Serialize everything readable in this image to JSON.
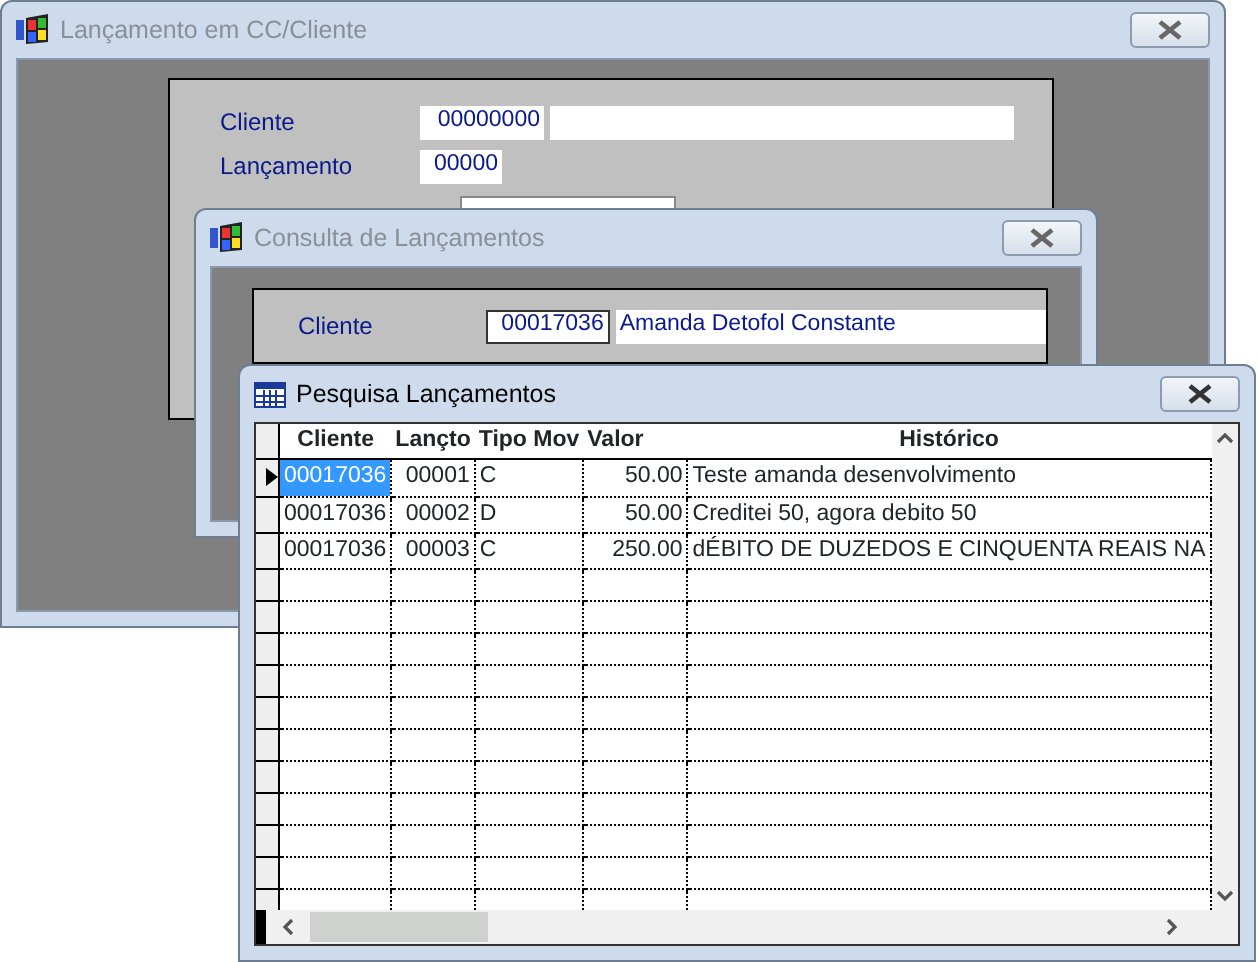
{
  "windows": [
    {
      "kind": "form",
      "title": "Lançamento em CC/Cliente",
      "active": false,
      "fields": [
        {
          "label": "Cliente",
          "values": [
            "00000000"
          ],
          "name_field": true
        },
        {
          "label": "Lançamento",
          "values": [
            "00000"
          ]
        }
      ]
    },
    {
      "kind": "form",
      "title": "Consulta de Lançamentos",
      "active": false,
      "fields": [
        {
          "label": "Cliente",
          "values": [
            "00017036",
            "Amanda Detofol Constante"
          ]
        }
      ]
    },
    {
      "kind": "grid",
      "title": "Pesquisa Lançamentos",
      "active": true,
      "table": {
        "columns": [
          "Cliente",
          "Lançto",
          "Tipo Mov",
          "Valor",
          "Histórico"
        ],
        "rows": [
          {
            "selected": true,
            "cells": [
              "00017036",
              "00001",
              "C",
              "50.00",
              "Teste amanda desenvolvimento"
            ]
          },
          {
            "selected": false,
            "cells": [
              "00017036",
              "00002",
              "D",
              "50.00",
              "Creditei 50, agora debito 50"
            ]
          },
          {
            "selected": false,
            "cells": [
              "00017036",
              "00003",
              "C",
              "250.00",
              "dÉBITO DE DUZEDOS E CINQUENTA REAIS NA"
            ]
          }
        ]
      }
    }
  ]
}
